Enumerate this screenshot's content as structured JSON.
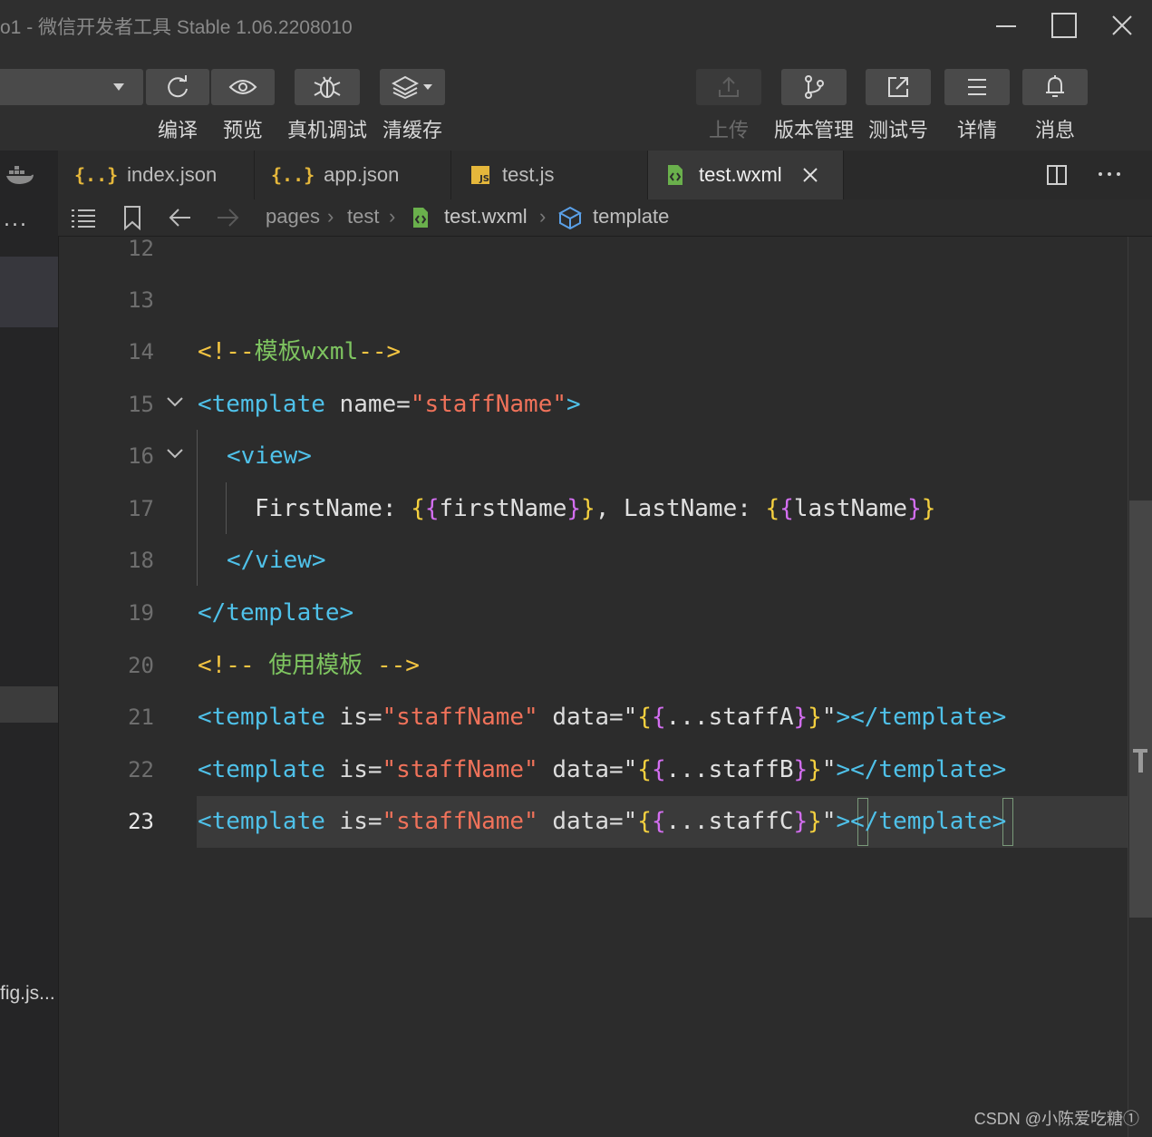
{
  "window": {
    "title": "o1 - 微信开发者工具 Stable 1.06.2208010",
    "minimize_icon": "minimize-icon",
    "maximize_icon": "maximize-icon",
    "close_icon": "close-icon"
  },
  "toolbar": {
    "left_buttons": [
      {
        "label": "编译",
        "icon": "refresh-icon"
      },
      {
        "label": "预览",
        "icon": "eye-icon"
      },
      {
        "label": "真机调试",
        "icon": "bug-icon"
      },
      {
        "label": "清缓存",
        "icon": "layers-icon"
      }
    ],
    "right_buttons": [
      {
        "label": "上传",
        "icon": "upload-icon",
        "disabled": true
      },
      {
        "label": "版本管理",
        "icon": "branch-icon"
      },
      {
        "label": "测试号",
        "icon": "external-link-icon"
      },
      {
        "label": "详情",
        "icon": "menu-icon"
      },
      {
        "label": "消息",
        "icon": "bell-icon"
      }
    ]
  },
  "tabs": [
    {
      "name": "index.json",
      "icon": "json-icon"
    },
    {
      "name": "app.json",
      "icon": "json-icon"
    },
    {
      "name": "test.js",
      "icon": "js-icon"
    },
    {
      "name": "test.wxml",
      "icon": "wxml-icon",
      "active": true
    }
  ],
  "breadcrumb": [
    "pages",
    "test",
    "test.wxml",
    "template"
  ],
  "sidebar": {
    "more": "...",
    "file_item": "fig.js..."
  },
  "editor": {
    "current_line": 23,
    "lines": [
      {
        "num": "12",
        "text": ""
      },
      {
        "num": "13",
        "text": ""
      },
      {
        "num": "14",
        "text": "<!--模板wxml-->"
      },
      {
        "num": "15",
        "text": "<template name=\"staffName\">"
      },
      {
        "num": "16",
        "text": "<view>"
      },
      {
        "num": "17",
        "text": "FirstName: {{firstName}}, LastName: {{lastName}}"
      },
      {
        "num": "18",
        "text": "</view>"
      },
      {
        "num": "19",
        "text": "</template>"
      },
      {
        "num": "20",
        "text": "<!-- 使用模板 -->"
      },
      {
        "num": "21",
        "text": "<template is=\"staffName\" data=\"{{...staffA}}\"></template>"
      },
      {
        "num": "22",
        "text": "<template is=\"staffName\" data=\"{{...staffB}}\"></template>"
      },
      {
        "num": "23",
        "text": "<template is=\"staffName\" data=\"{{...staffC}}\"></template>"
      }
    ]
  },
  "watermark": "CSDN @小陈爱吃糖①"
}
